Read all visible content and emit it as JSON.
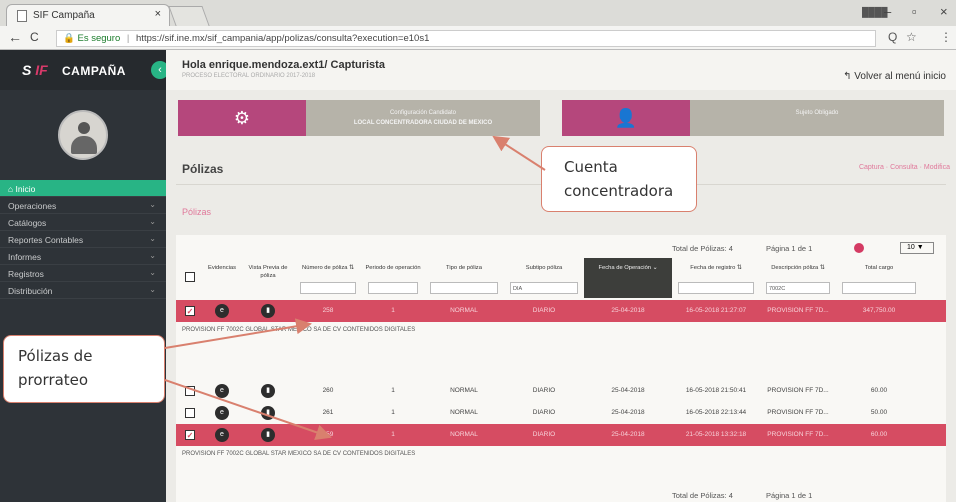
{
  "browser": {
    "tab_title": "SIF Campaña",
    "tab_close": "×",
    "secure_label": "Es seguro",
    "url": "https://sif.ine.mx/sif_campania/app/polizas/consulta?execution=e10s1",
    "window_user": "████",
    "nav_back": "←",
    "nav_reload": "C",
    "lock": "🔒",
    "win_min": "–",
    "win_max": "▫",
    "win_close": "×",
    "tool_zoom": "Q",
    "tool_star": "☆",
    "tool_menu": "⋮"
  },
  "sidebar": {
    "logo_prefix": "S",
    "logo_mark": "IF",
    "brand": "CAMPAÑA",
    "toggle": "‹",
    "menu": [
      {
        "label": "⌂ Inicio",
        "active": true,
        "chevron": ""
      },
      {
        "label": "Operaciones",
        "chevron": "⌄"
      },
      {
        "label": "Catálogos",
        "chevron": "⌄"
      },
      {
        "label": "Reportes Contables",
        "chevron": "⌄"
      },
      {
        "label": "Informes",
        "chevron": "⌄"
      },
      {
        "label": "Registros",
        "chevron": "⌄"
      },
      {
        "label": "Distribución",
        "chevron": "⌄"
      }
    ]
  },
  "header": {
    "greeting": "Hola enrique.mendoza.ext1/ Capturista",
    "subline": "PROCESO ELECTORAL ORDINARIO 2017-2018",
    "back_link": "Volver al menú inicio",
    "back_icon": "↰"
  },
  "cards": [
    {
      "icon": "⚙",
      "line1": "Configuración Candidato",
      "line2": "LOCAL CONCENTRADORA CIUDAD DE MEXICO"
    },
    {
      "icon": "👤",
      "line1": "Sujeto Obligado",
      "line2": ""
    }
  ],
  "page": {
    "title": "Pólizas",
    "links": "Captura · Consulta · Modifica",
    "subtitle": "Pólizas"
  },
  "table": {
    "total_top": "Total de Pólizas: 4",
    "page_top": "Página 1 de 1",
    "page_size": "10 ▼",
    "total_bottom": "Total de Pólizas: 4",
    "page_bottom": "Página 1 de 1",
    "headers": [
      {
        "label": "",
        "filter": null
      },
      {
        "label": "Evidencias",
        "filter": null
      },
      {
        "label": "Vista Previa de póliza",
        "filter": null
      },
      {
        "label": "Número de póliza ⇅",
        "filter": ""
      },
      {
        "label": "Periodo de operación",
        "filter": ""
      },
      {
        "label": "Tipo de póliza",
        "filter": ""
      },
      {
        "label": "Subtipo póliza",
        "filter": "DIA"
      },
      {
        "label": "Fecha de Operación ⌄",
        "filter": null
      },
      {
        "label": "Fecha de registro ⇅",
        "filter": ""
      },
      {
        "label": "Descripción póliza ⇅",
        "filter": "7002C"
      },
      {
        "label": "Total cargo",
        "filter": ""
      }
    ],
    "rows": [
      {
        "selected": true,
        "check": "✓",
        "numero": "258",
        "periodo": "1",
        "tipo": "NORMAL",
        "subtipo": "DIARIO",
        "fecha_op": "25-04-2018",
        "fecha_reg": "16-05-2018 21:27:07",
        "descripcion": "PROVISION FF 7D...",
        "cargo": "347,750.00",
        "concept": "PROVISION FF 7002C GLOBAL STAR MEXICO SA DE CV CONTENIDOS DIGITALES"
      },
      {
        "selected": false,
        "check": "",
        "numero": "260",
        "periodo": "1",
        "tipo": "NORMAL",
        "subtipo": "DIARIO",
        "fecha_op": "25-04-2018",
        "fecha_reg": "16-05-2018 21:50:41",
        "descripcion": "PROVISION FF 7D...",
        "cargo": "60.00",
        "concept": ""
      },
      {
        "selected": false,
        "check": "",
        "numero": "261",
        "periodo": "1",
        "tipo": "NORMAL",
        "subtipo": "DIARIO",
        "fecha_op": "25-04-2018",
        "fecha_reg": "16-05-2018 22:13:44",
        "descripcion": "PROVISION FF 7D...",
        "cargo": "50.00",
        "concept": ""
      },
      {
        "selected": true,
        "check": "✓",
        "numero": "259",
        "periodo": "1",
        "tipo": "NORMAL",
        "subtipo": "DIARIO",
        "fecha_op": "25-04-2018",
        "fecha_reg": "21-05-2018 13:32:18",
        "descripcion": "PROVISION FF 7D...",
        "cargo": "60.00",
        "concept": "PROVISION FF 7002C GLOBAL STAR MEXICO SA DE CV CONTENIDOS DIGITALES"
      }
    ],
    "icon_evidence": "e",
    "icon_preview": "▮"
  },
  "callouts": {
    "concentradora": [
      "Cuenta",
      "concentradora"
    ],
    "prorrateo": [
      "Pólizas de",
      "prorrateo"
    ]
  },
  "colors": {
    "accent": "#28b485",
    "magenta": "#b5477c",
    "selected_row": "#d64c62",
    "arrow": "#d9806e"
  }
}
